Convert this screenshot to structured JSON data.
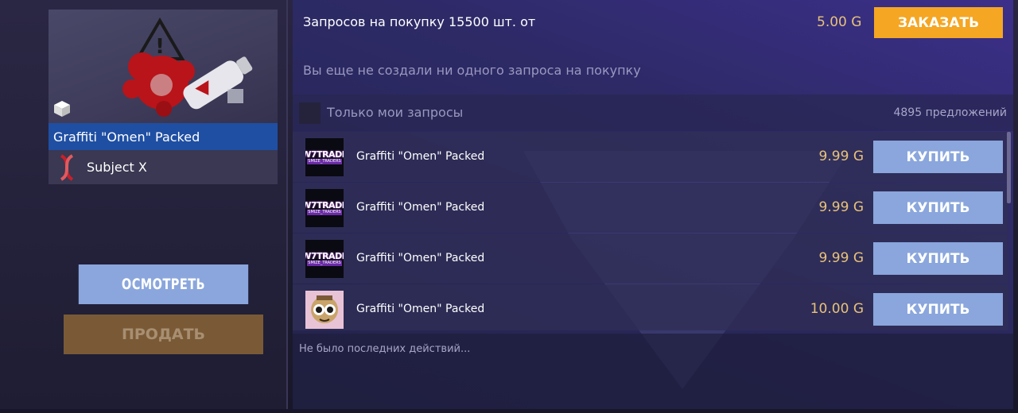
{
  "item": {
    "name": "Graffiti \"Omen\" Packed",
    "collection": "Subject X",
    "image_icon": "graffiti-omen-spray-image"
  },
  "actions": {
    "inspect_label": "ОСМОТРЕТЬ",
    "sell_label": "ПРОДАТЬ"
  },
  "requests": {
    "text": "Запросов на покупку 15500 шт. от",
    "price": "5.00",
    "order_label": "ЗАКАЗАТЬ",
    "empty_text": "Вы еще не создали ни одного запроса на покупку"
  },
  "filter": {
    "only_mine_label": "Только мои запросы",
    "offers_count": "4895 предложений"
  },
  "listings": [
    {
      "name": "Graffiti \"Omen\" Packed",
      "price": "9.99",
      "buy_label": "КУПИТЬ",
      "avatar": "w7trade"
    },
    {
      "name": "Graffiti \"Omen\" Packed",
      "price": "9.99",
      "buy_label": "КУПИТЬ",
      "avatar": "w7trade"
    },
    {
      "name": "Graffiti \"Omen\" Packed",
      "price": "9.99",
      "buy_label": "КУПИТЬ",
      "avatar": "w7trade"
    },
    {
      "name": "Graffiti \"Omen\" Packed",
      "price": "10.00",
      "buy_label": "КУПИТЬ",
      "avatar": "cartoon-character"
    }
  ],
  "avatar_text": {
    "line1": "W7TRADE",
    "line2": "SMIZE_TRADERS"
  },
  "currency_symbol": "G",
  "recent": {
    "text": "Не было последних действий..."
  },
  "colors": {
    "accent_orange": "#f5a623",
    "buy_blue": "#8aa6dc",
    "price_gold": "#e8c27a",
    "selected_blue": "#1f4fa3"
  }
}
